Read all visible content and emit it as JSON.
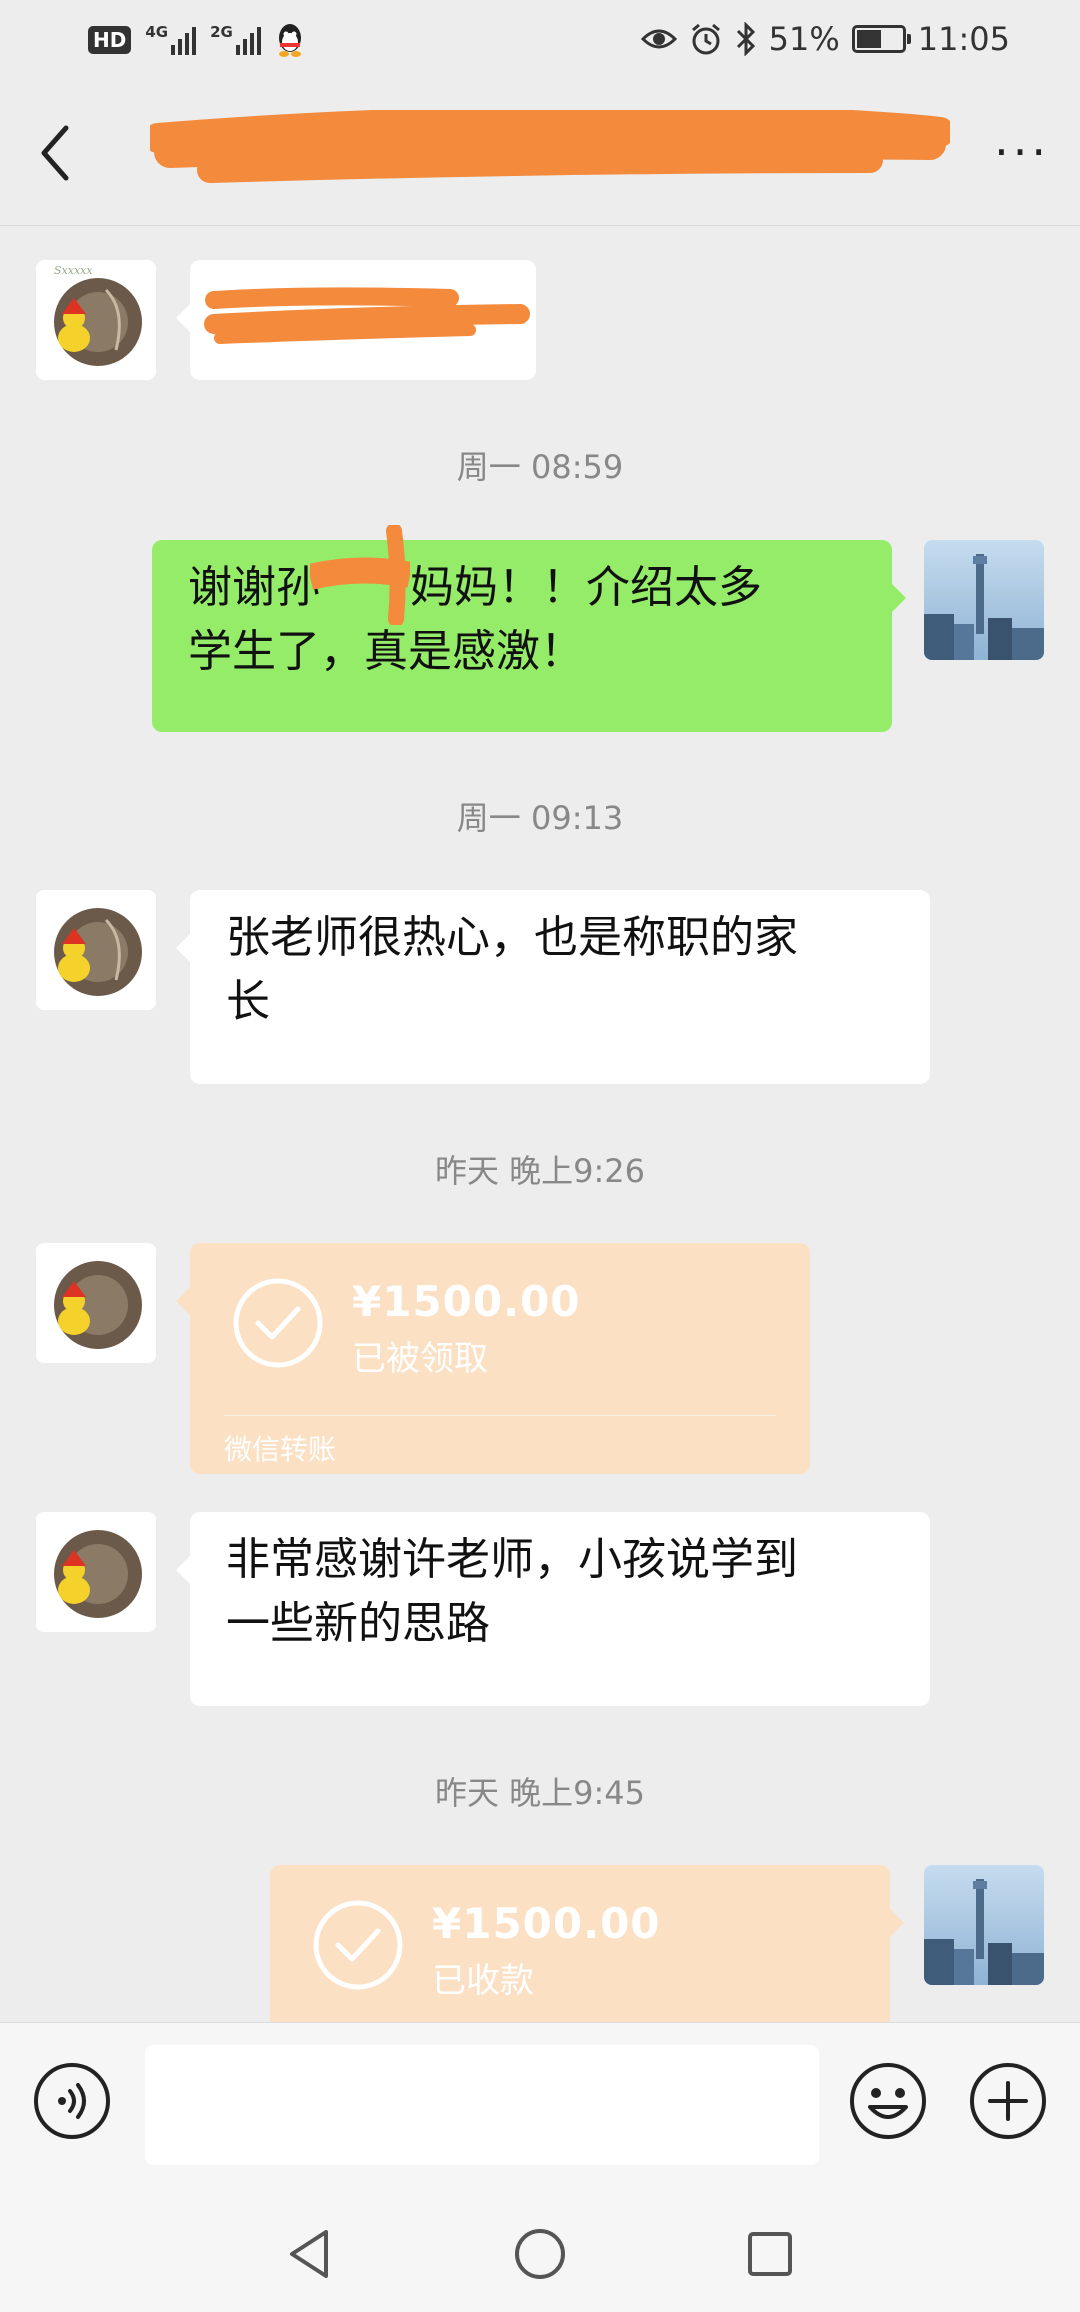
{
  "status_bar": {
    "hd": "HD",
    "net1": "4G",
    "net2": "2G",
    "battery": "51%",
    "time": "11:05",
    "icons": [
      "hd-icon",
      "signal-4g-icon",
      "signal-2g-icon",
      "qq-icon",
      "eye-icon",
      "alarm-icon",
      "bluetooth-icon",
      "battery-icon"
    ]
  },
  "header": {
    "title_redacted": true,
    "back_icon": "chevron-left-icon",
    "more_label": "···"
  },
  "messages": {
    "m1": {
      "side": "left",
      "text_redacted": true
    },
    "t1": "周一 08:59",
    "m2": {
      "side": "right",
      "line1_a": "谢谢孙",
      "line1_b": "妈妈！！介绍太多",
      "line2": "学生了，真是感激！"
    },
    "t2": "周一 09:13",
    "m3": {
      "side": "left",
      "line1": "张老师很热心，也是称职的家",
      "line2": "长"
    },
    "t3": "昨天 晚上9:26",
    "m4": {
      "side": "left",
      "type": "transfer",
      "amount": "¥1500.00",
      "status": "已被领取",
      "footer": "微信转账"
    },
    "m5": {
      "side": "left",
      "line1": "非常感谢许老师，小孩说学到",
      "line2": "一些新的思路"
    },
    "t4": "昨天 晚上9:45",
    "m6": {
      "side": "right",
      "type": "transfer",
      "amount": "¥1500.00",
      "status": "已收款"
    }
  },
  "input_bar": {
    "placeholder": "",
    "icons": [
      "voice-icon",
      "emoji-icon",
      "plus-icon"
    ]
  },
  "nav_bar": {
    "icons": [
      "nav-back-icon",
      "nav-home-icon",
      "nav-recents-icon"
    ]
  },
  "colors": {
    "background": "#ededed",
    "green_bubble": "#95ec69",
    "transfer_bubble": "#fbe0c4",
    "redaction": "#f38a3c"
  }
}
